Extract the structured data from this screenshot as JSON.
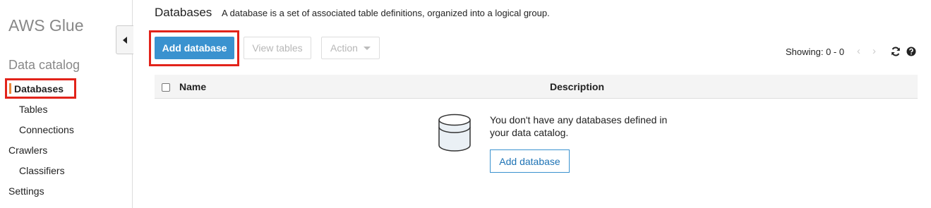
{
  "sidebar": {
    "app_title": "AWS Glue",
    "section_title": "Data catalog",
    "items": [
      {
        "label": "Databases"
      },
      {
        "label": "Tables"
      },
      {
        "label": "Connections"
      },
      {
        "label": "Crawlers"
      },
      {
        "label": "Classifiers"
      },
      {
        "label": "Settings"
      }
    ]
  },
  "header": {
    "title": "Databases",
    "description": "A database is a set of associated table definitions, organized into a logical group."
  },
  "toolbar": {
    "add_label": "Add database",
    "view_tables_label": "View tables",
    "action_label": "Action",
    "showing": "Showing: 0 - 0"
  },
  "table": {
    "columns": [
      "Name",
      "Description"
    ]
  },
  "empty_state": {
    "message": "You don't have any databases defined in your data catalog.",
    "button_label": "Add database"
  },
  "colors": {
    "primary": "#3a92cf",
    "highlight": "#e2231a"
  }
}
